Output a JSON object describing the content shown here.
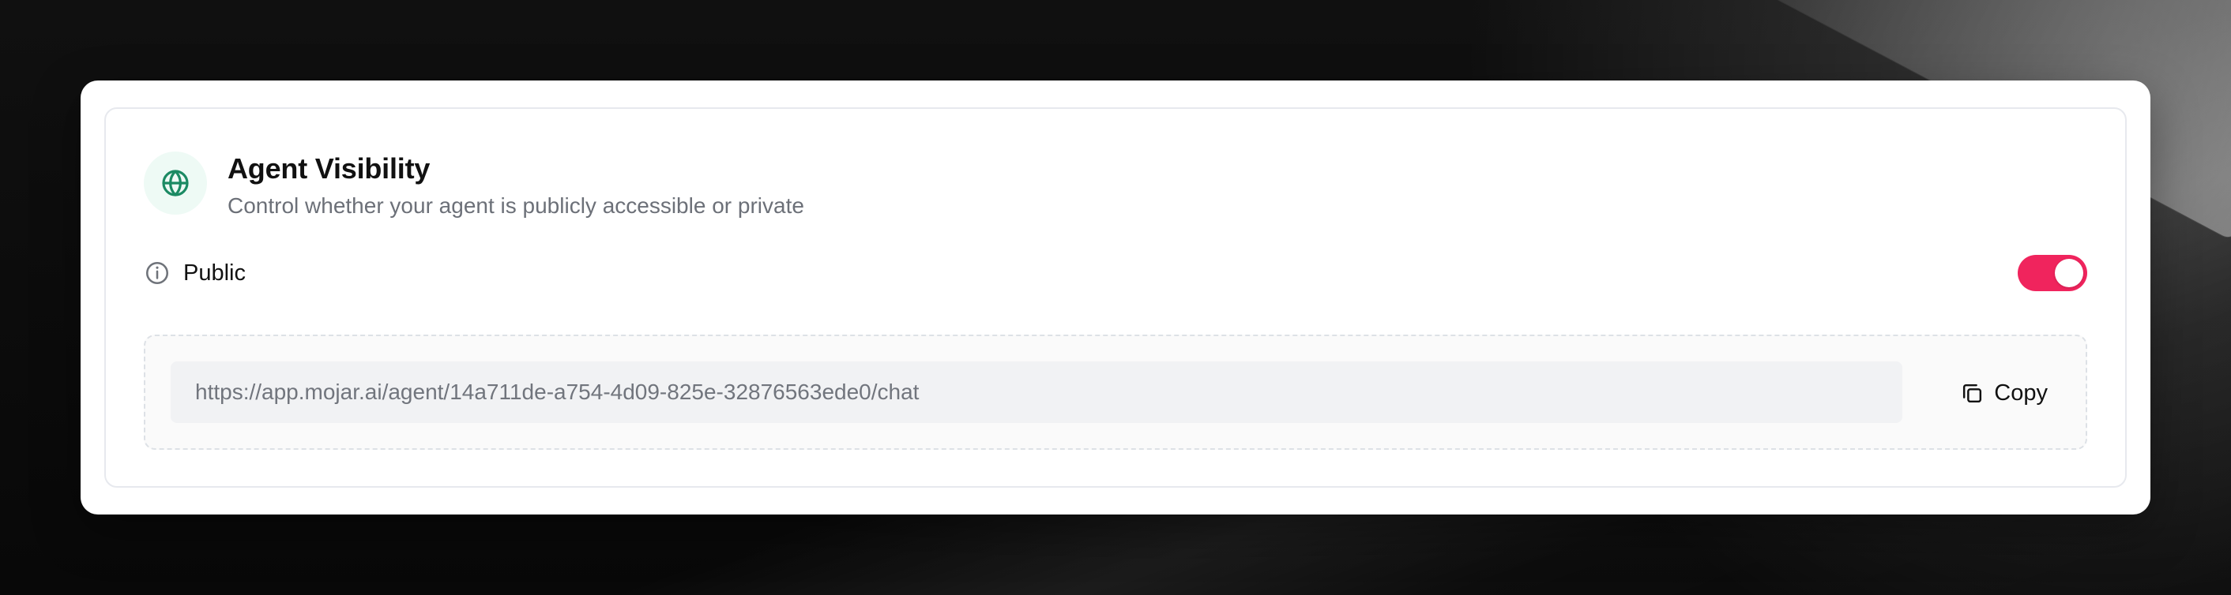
{
  "background": {
    "accent_color": "#0b0b0b"
  },
  "card": {
    "title": "Agent Visibility",
    "subtitle": "Control whether your agent is publicly accessible or private",
    "icon": "globe-icon",
    "icon_color": "#1b8a63",
    "icon_background": "#eefaf5"
  },
  "visibility": {
    "label": "Public",
    "icon": "info-icon",
    "toggle_state": "on",
    "toggle_color": "#f0245d"
  },
  "share_link": {
    "value": "https://app.mojar.ai/agent/14a711de-a754-4d09-825e-32876563ede0/chat",
    "copy_label": "Copy",
    "copy_icon": "copy-icon"
  }
}
